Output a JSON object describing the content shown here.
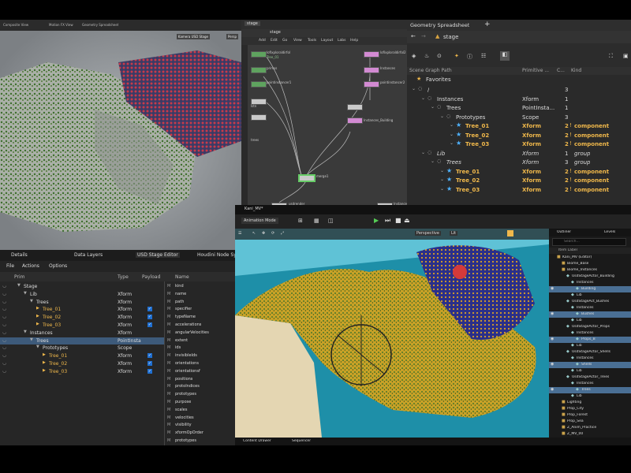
{
  "top_tabs": [
    "Composite View",
    "Motion FX View",
    "Geometry Spreadsheet"
  ],
  "viewport_top": {
    "camera_label": "Kamera USD Stage",
    "view_label": "Persp"
  },
  "network": {
    "path": "stage",
    "menu": [
      "Add",
      "Edit",
      "Go",
      "View",
      "Tools",
      "Layout",
      "Labs",
      "Help"
    ],
    "nodes": [
      {
        "name": "lofixploraldirfol",
        "sub": "Tree_01"
      },
      {
        "name": "lofixploraldirfol2",
        "sub": "Tree_02"
      },
      {
        "name": "primss",
        "sub": ""
      },
      {
        "name": "pointinstancer1",
        "sub": ""
      },
      {
        "name": "pointinstancer2",
        "sub": ""
      },
      {
        "name": "lstn",
        "sub": ""
      },
      {
        "name": "trees",
        "sub": ""
      },
      {
        "name": "Instances",
        "sub": ""
      },
      {
        "name": "Instances_Building",
        "sub": ""
      },
      {
        "name": "merge1",
        "sub": ""
      },
      {
        "name": "usdrender",
        "sub": ""
      },
      {
        "name": "Instances",
        "sub": ""
      }
    ]
  },
  "spreadsheet": {
    "title": "Geometry Spreadsheet",
    "path": "stage",
    "headers": [
      "Scene Graph Path",
      "Primitive ...",
      "C...",
      "Kind"
    ],
    "favorites": "Favorites",
    "rows": [
      {
        "indent": 0,
        "label": "/",
        "type": "",
        "count": "3",
        "kind": "",
        "gold": false,
        "italic": false
      },
      {
        "indent": 1,
        "label": "Instances",
        "type": "Xform",
        "count": "1",
        "kind": "",
        "gold": false,
        "italic": false
      },
      {
        "indent": 2,
        "label": "Trees",
        "type": "PointInsta...",
        "count": "1",
        "kind": "",
        "gold": false,
        "italic": false
      },
      {
        "indent": 3,
        "label": "Prototypes",
        "type": "Scope",
        "count": "3",
        "kind": "",
        "gold": false,
        "italic": false
      },
      {
        "indent": 4,
        "label": "Tree_01",
        "type": "Xform",
        "count": "2",
        "kind": "component",
        "gold": true,
        "italic": false
      },
      {
        "indent": 4,
        "label": "Tree_02",
        "type": "Xform",
        "count": "2",
        "kind": "component",
        "gold": true,
        "italic": false
      },
      {
        "indent": 4,
        "label": "Tree_03",
        "type": "Xform",
        "count": "2",
        "kind": "component",
        "gold": true,
        "italic": false
      },
      {
        "indent": 1,
        "label": "Lib",
        "type": "Xform",
        "count": "1",
        "kind": "group",
        "gold": false,
        "italic": true
      },
      {
        "indent": 2,
        "label": "Trees",
        "type": "Xform",
        "count": "3",
        "kind": "group",
        "gold": false,
        "italic": true
      },
      {
        "indent": 3,
        "label": "Tree_01",
        "type": "Xform",
        "count": "2",
        "kind": "component",
        "gold": true,
        "italic": false
      },
      {
        "indent": 3,
        "label": "Tree_02",
        "type": "Xform",
        "count": "2",
        "kind": "component",
        "gold": true,
        "italic": false
      },
      {
        "indent": 3,
        "label": "Tree_03",
        "type": "Xform",
        "count": "2",
        "kind": "component",
        "gold": true,
        "italic": false
      }
    ]
  },
  "stage_editor": {
    "tabs": [
      "Details",
      "Data Layers",
      "USD Stage Editor",
      "Houdini Node Sy"
    ],
    "menu": [
      "File",
      "Actions",
      "Options"
    ],
    "headers": [
      "Prim",
      "Type",
      "Payload",
      "Name"
    ],
    "rows": [
      {
        "indent": 0,
        "label": "Stage",
        "type": "",
        "payload": false,
        "gold": false,
        "selected": false
      },
      {
        "indent": 1,
        "label": "Lib",
        "type": "Xform",
        "payload": false,
        "gold": false,
        "selected": false
      },
      {
        "indent": 2,
        "label": "Trees",
        "type": "Xform",
        "payload": false,
        "gold": false,
        "selected": false
      },
      {
        "indent": 3,
        "label": "Tree_01",
        "type": "Xform",
        "payload": true,
        "gold": true,
        "selected": false
      },
      {
        "indent": 3,
        "label": "Tree_02",
        "type": "Xform",
        "payload": true,
        "gold": true,
        "selected": false
      },
      {
        "indent": 3,
        "label": "Tree_03",
        "type": "Xform",
        "payload": true,
        "gold": true,
        "selected": false
      },
      {
        "indent": 1,
        "label": "Instances",
        "type": "Xform",
        "payload": false,
        "gold": false,
        "selected": false
      },
      {
        "indent": 2,
        "label": "Trees",
        "type": "PointInsta",
        "payload": false,
        "gold": false,
        "selected": true
      },
      {
        "indent": 3,
        "label": "Prototypes",
        "type": "Scope",
        "payload": false,
        "gold": false,
        "selected": false
      },
      {
        "indent": 4,
        "label": "Tree_01",
        "type": "Xform",
        "payload": true,
        "gold": true,
        "selected": false
      },
      {
        "indent": 4,
        "label": "Tree_02",
        "type": "Xform",
        "payload": true,
        "gold": true,
        "selected": false
      },
      {
        "indent": 4,
        "label": "Tree_03",
        "type": "Xform",
        "payload": true,
        "gold": true,
        "selected": false
      }
    ],
    "attributes": [
      "kind",
      "name",
      "path",
      "specifier",
      "typeName",
      "accelerations",
      "angularVelocities",
      "extent",
      "ids",
      "invisibleIds",
      "orientations",
      "orientationsf",
      "positions",
      "protoIndices",
      "prototypes",
      "purpose",
      "scales",
      "velocities",
      "visibility",
      "xformOpOrder",
      "prototypes"
    ]
  },
  "unreal": {
    "level_tab": "Kani_MV*",
    "mode": "Animation Mode",
    "perspective": "Perspective",
    "lit": "Lit",
    "outliner_title": "Outliner",
    "levels_title": "Levels",
    "search_placeholder": "Search...",
    "outliner_header": "Item Label",
    "outliner_items": [
      {
        "indent": 0,
        "label": "Kani_MV (Editor)",
        "sel": false
      },
      {
        "indent": 1,
        "label": "Biome_Base",
        "sel": false
      },
      {
        "indent": 1,
        "label": "Biome_Instances",
        "sel": false
      },
      {
        "indent": 2,
        "label": "UsdStageActor_Building",
        "sel": false
      },
      {
        "indent": 3,
        "label": "Instances",
        "sel": false
      },
      {
        "indent": 4,
        "label": "Building",
        "sel": true
      },
      {
        "indent": 3,
        "label": "Lib",
        "sel": false
      },
      {
        "indent": 2,
        "label": "UsdStageAct_Bushes",
        "sel": false
      },
      {
        "indent": 3,
        "label": "Instances",
        "sel": false
      },
      {
        "indent": 4,
        "label": "Bushes",
        "sel": true
      },
      {
        "indent": 3,
        "label": "Lib",
        "sel": false
      },
      {
        "indent": 2,
        "label": "UsdStageActor_Props",
        "sel": false
      },
      {
        "indent": 3,
        "label": "Instances",
        "sel": false
      },
      {
        "indent": 4,
        "label": "Props_B",
        "sel": true
      },
      {
        "indent": 3,
        "label": "Lib",
        "sel": false
      },
      {
        "indent": 2,
        "label": "UsdStageActor_Shells",
        "sel": false
      },
      {
        "indent": 3,
        "label": "Instances",
        "sel": false
      },
      {
        "indent": 4,
        "label": "Shells",
        "sel": true
      },
      {
        "indent": 3,
        "label": "Lib",
        "sel": false
      },
      {
        "indent": 2,
        "label": "UsdStageActor_Trees",
        "sel": false
      },
      {
        "indent": 3,
        "label": "Instances",
        "sel": false
      },
      {
        "indent": 4,
        "label": "Trees",
        "sel": true
      },
      {
        "indent": 3,
        "label": "Lib",
        "sel": false
      },
      {
        "indent": 1,
        "label": "Lighting",
        "sel": false
      },
      {
        "indent": 1,
        "label": "Prop_City",
        "sel": false
      },
      {
        "indent": 1,
        "label": "Prop_Forest",
        "sel": false
      },
      {
        "indent": 1,
        "label": "Prop_Sea",
        "sel": false
      },
      {
        "indent": 1,
        "label": "Z_Anim_Practice",
        "sel": false
      },
      {
        "indent": 1,
        "label": "Z_MV_00",
        "sel": false
      }
    ],
    "bottom_tabs": [
      "Content Drawer",
      "Sequencer"
    ]
  },
  "colors": {
    "accent_gold": "#f0b84b",
    "selection_blue": "#3d5a7a",
    "houdini_panel": "#262626",
    "ue_terrain": "#c9a227"
  }
}
